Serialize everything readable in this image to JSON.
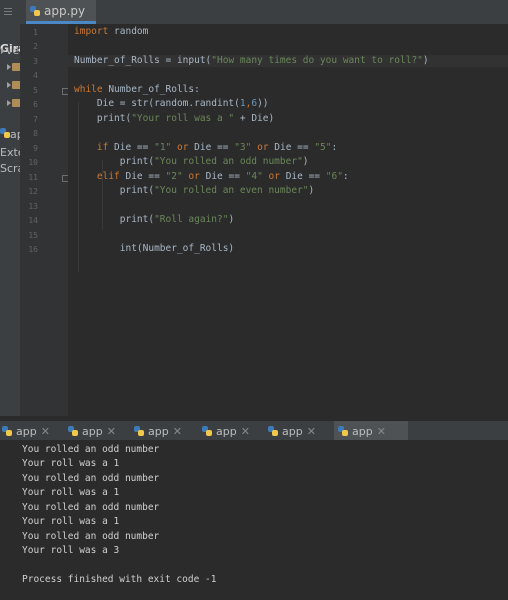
{
  "editor_tab": {
    "label": "app.py"
  },
  "project_tree": {
    "root_label": "Giraf",
    "items": [
      "ve",
      "",
      "",
      "",
      "ap",
      "Exter",
      "Scrat"
    ]
  },
  "line_numbers": [
    "1",
    "2",
    "3",
    "4",
    "5",
    "6",
    "7",
    "8",
    "9",
    "10",
    "11",
    "12",
    "13",
    "14",
    "15",
    "16"
  ],
  "code": {
    "l1_kw": "import",
    "l1_rest": " random",
    "l3_a": "Number_of_Rolls = input(",
    "l3_str": "\"How many times do you want to roll?\"",
    "l3_b": ")",
    "l5_kw": "while",
    "l5_rest": " Number_of_Rolls:",
    "l6_a": "    Die = str(random.randint(",
    "l6_n1": "1",
    "l6_c": ",",
    "l6_n2": "6",
    "l6_b": "))",
    "l7_a": "    print(",
    "l7_str": "\"Your roll was a \"",
    "l7_b": " + Die)",
    "l9_kw1": "    if",
    "l9_a": " Die == ",
    "l9_s1": "\"1\"",
    "l9_or1": " or",
    "l9_b": " Die == ",
    "l9_s2": "\"3\"",
    "l9_or2": " or",
    "l9_c": " Die == ",
    "l9_s3": "\"5\"",
    "l9_d": ":",
    "l10_a": "        print(",
    "l10_str": "\"You rolled an odd number\"",
    "l10_b": ")",
    "l11_kw1": "    elif",
    "l11_a": " Die == ",
    "l11_s1": "\"2\"",
    "l11_or1": " or",
    "l11_b": " Die == ",
    "l11_s2": "\"4\"",
    "l11_or2": " or",
    "l11_c": " Die == ",
    "l11_s3": "\"6\"",
    "l11_d": ":",
    "l12_a": "        print(",
    "l12_str": "\"You rolled an even number\"",
    "l12_b": ")",
    "l14_a": "        print(",
    "l14_str": "\"Roll again?\"",
    "l14_b": ")",
    "l16": "        int(Number_of_Rolls)"
  },
  "run_tabs": [
    {
      "label": "app"
    },
    {
      "label": "app"
    },
    {
      "label": "app"
    },
    {
      "label": "app"
    },
    {
      "label": "app"
    },
    {
      "label": "app"
    }
  ],
  "console_lines": [
    "You rolled an odd number",
    "Your roll was a 1",
    "You rolled an odd number",
    "Your roll was a 1",
    "You rolled an odd number",
    "Your roll was a 1",
    "You rolled an odd number",
    "Your roll was a 3",
    "",
    "Process finished with exit code -1"
  ],
  "colors": {
    "keyword": "#cc7832",
    "string": "#6a8759",
    "number": "#6897bb",
    "text": "#a9b7c6",
    "background": "#2b2b2b"
  }
}
